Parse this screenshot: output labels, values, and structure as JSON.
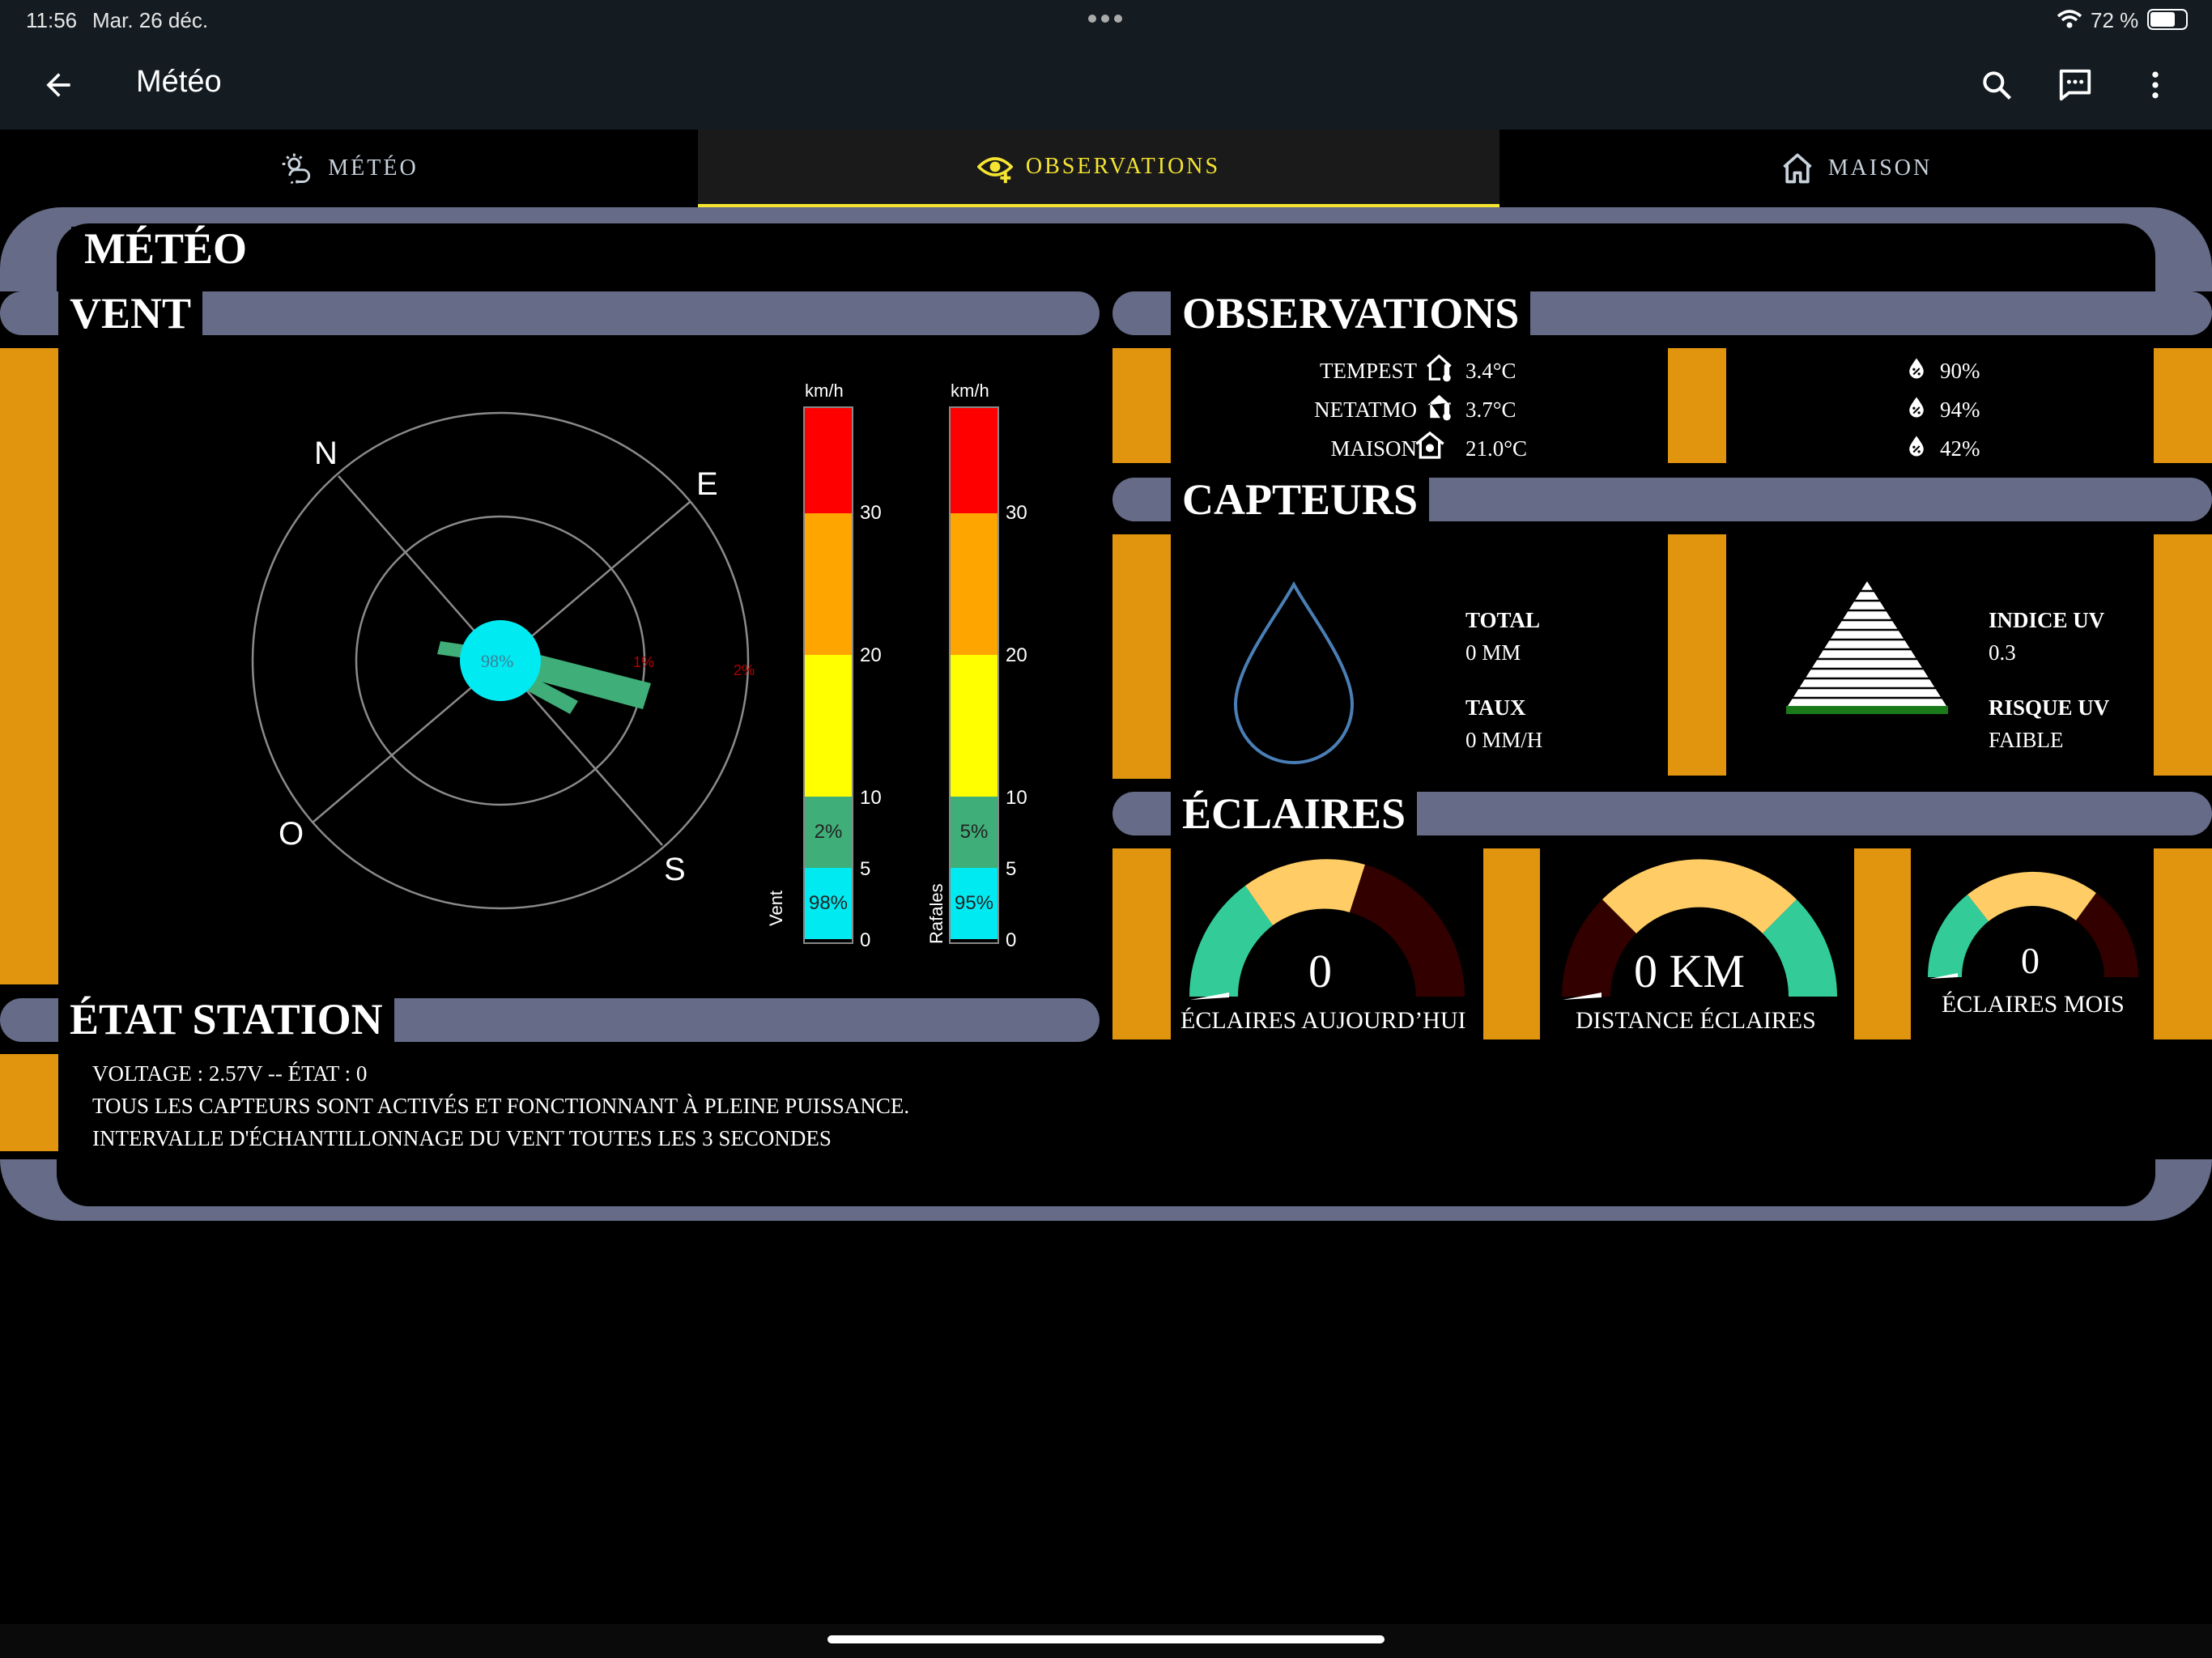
{
  "status_bar": {
    "time": "11:56",
    "date": "Mar. 26 déc.",
    "battery": "72 %"
  },
  "app_bar": {
    "title": "Météo"
  },
  "tabs": [
    {
      "label": "MÉTÉO",
      "icon": "weather-icon",
      "active": false
    },
    {
      "label": "OBSERVATIONS",
      "icon": "eye-icon",
      "active": true
    },
    {
      "label": "MAISON",
      "icon": "home-icon",
      "active": false
    }
  ],
  "panel_title": "MÉTÉO",
  "vent": {
    "title": "VENT",
    "compass": {
      "n": "N",
      "e": "E",
      "s": "S",
      "o": "O",
      "center_calm": "98%",
      "ring_labels": [
        "1%",
        "2%"
      ]
    },
    "wind_bar": {
      "unit": "km/h",
      "label": "Vent",
      "pct_low": "98%",
      "pct_mid": "2%",
      "ticks": [
        "30",
        "20",
        "10",
        "5",
        "0"
      ]
    },
    "gust_bar": {
      "unit": "km/h",
      "label": "Rafales",
      "pct_low": "95%",
      "pct_mid": "5%",
      "ticks": [
        "30",
        "20",
        "10",
        "5",
        "0"
      ]
    }
  },
  "station": {
    "title": "ÉTAT STATION",
    "lines": [
      "VOLTAGE : 2.57V -- ÉTAT : 0",
      "TOUS LES CAPTEURS SONT ACTIVÉS ET FONCTIONNANT À PLEINE PUISSANCE.",
      "INTERVALLE D'ÉCHANTILLONNAGE DU VENT TOUTES LES 3 SECONDES"
    ]
  },
  "observations": {
    "title": "OBSERVATIONS",
    "rows": [
      {
        "name": "TEMPEST",
        "temp": "3.4°C",
        "humidity": "90%"
      },
      {
        "name": "NETATMO",
        "temp": "3.7°C",
        "humidity": "94%"
      },
      {
        "name": "MAISON",
        "temp": "21.0°C",
        "humidity": "42%"
      }
    ]
  },
  "capteurs": {
    "title": "CAPTEURS",
    "total_label": "TOTAL",
    "total_value": "0 MM",
    "taux_label": "TAUX",
    "taux_value": "0 MM/H",
    "uv_label": "INDICE UV",
    "uv_value": "0.3",
    "risk_label": "RISQUE UV",
    "risk_value": "FAIBLE"
  },
  "eclaires": {
    "title": "ÉCLAIRES",
    "gauges": [
      {
        "value": "0",
        "label": "ÉCLAIRES AUJOURD’HUI"
      },
      {
        "value": "0 KM",
        "label": "DISTANCE ÉCLAIRES"
      },
      {
        "value": "0",
        "label": "ÉCLAIRES MOIS"
      }
    ]
  },
  "colors": {
    "orange": "#e1940e",
    "slate": "#666b87",
    "accent": "#f5e431",
    "gauge_green": "#33cc99",
    "gauge_yellow": "#ffcc66",
    "gauge_dark": "#330000"
  }
}
